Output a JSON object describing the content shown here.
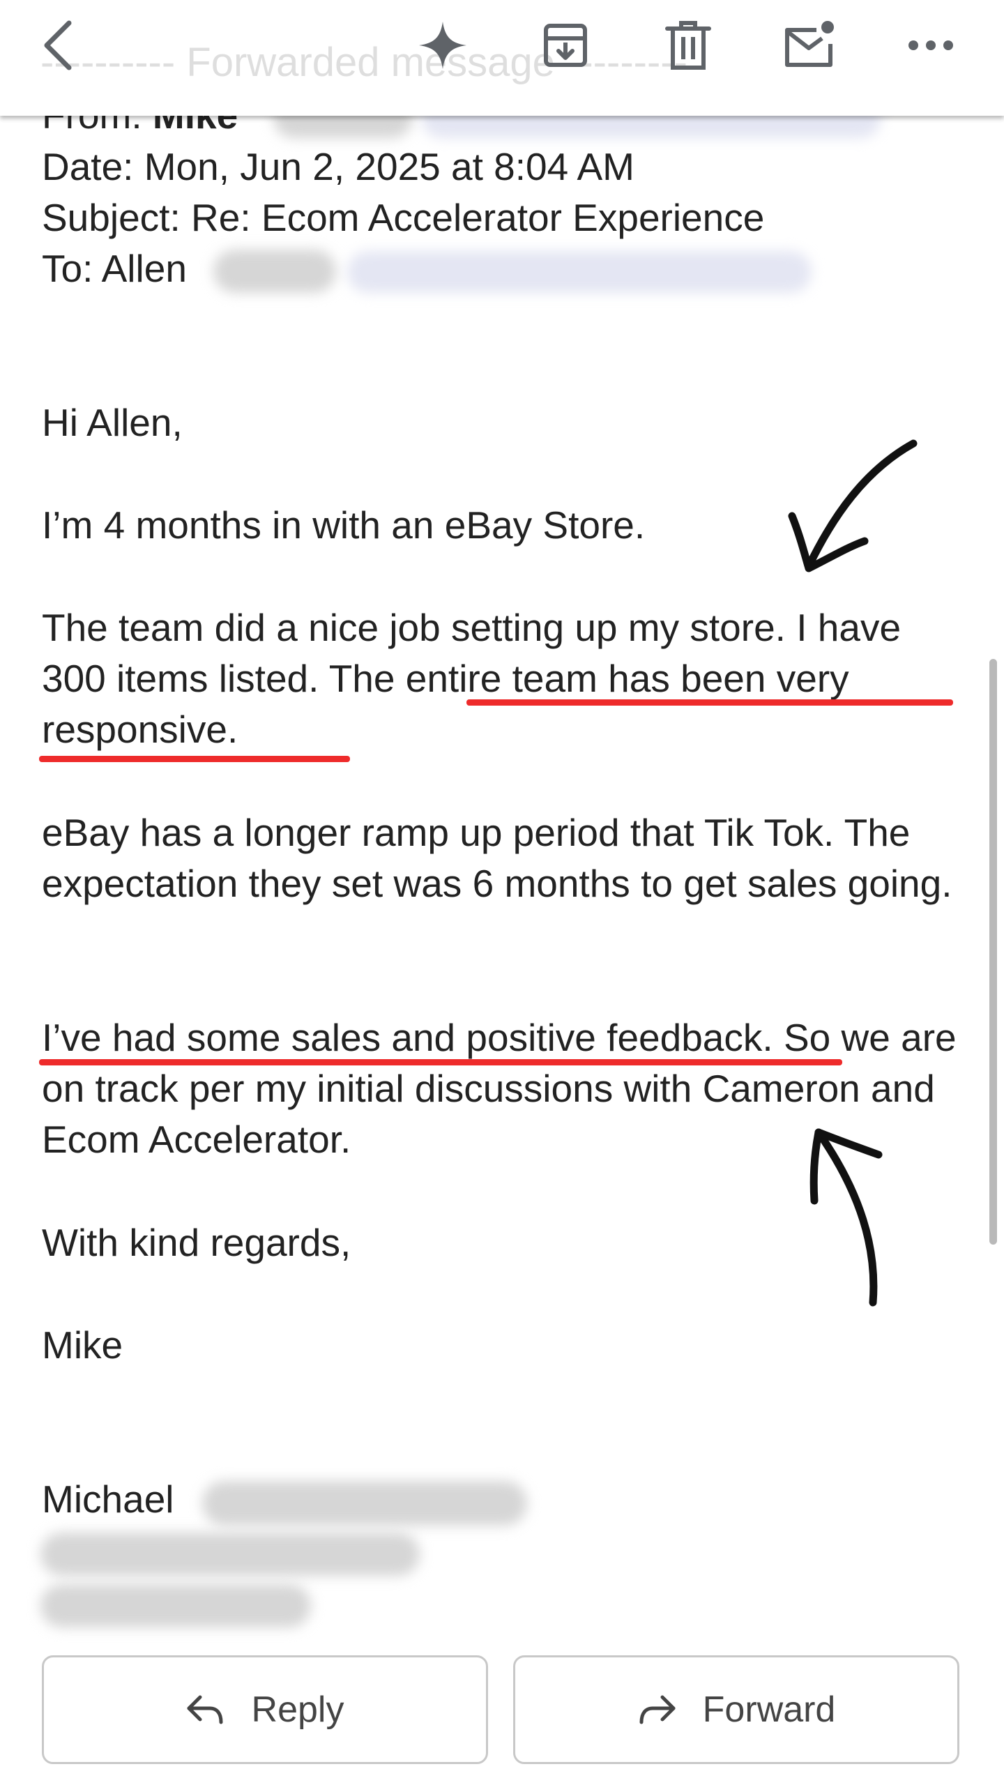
{
  "toolbar": {
    "ghost_text": "---------- Forwarded message ---------",
    "icons": [
      "back-icon",
      "sparkle-icon",
      "archive-icon",
      "trash-icon",
      "mark-unread-icon",
      "more-icon"
    ]
  },
  "email_header": {
    "from_label": "From:",
    "from_name": "Mike",
    "date_line": "Date: Mon, Jun 2, 2025 at 8:04 AM",
    "subject_line": "Subject: Re: Ecom Accelerator Experience",
    "to_label": "To: Allen"
  },
  "body": {
    "greeting": "Hi Allen,",
    "p1": "I’m 4 months in with an eBay Store.",
    "p2_plain": "The team did a nice job setting up my store. I have 300 items listed. ",
    "p2_highlight": "The entire team has been very responsive.",
    "p3": "eBay has a longer ramp up period that Tik Tok. The expectation they set was 6 months to get sales going.",
    "p4_highlight": "I’ve had some sales and positive feedback",
    "p4_plain": ". So we are on track per my initial discussions with Cameron and Ecom Accelerator.",
    "closing": "With kind regards,",
    "signoff": "Mike",
    "signature_name": "Michael"
  },
  "actions": {
    "reply_label": "Reply",
    "forward_label": "Forward"
  },
  "colors": {
    "highlight_underline": "#ee2b2b",
    "text": "#222222",
    "icon": "#5f6368"
  }
}
